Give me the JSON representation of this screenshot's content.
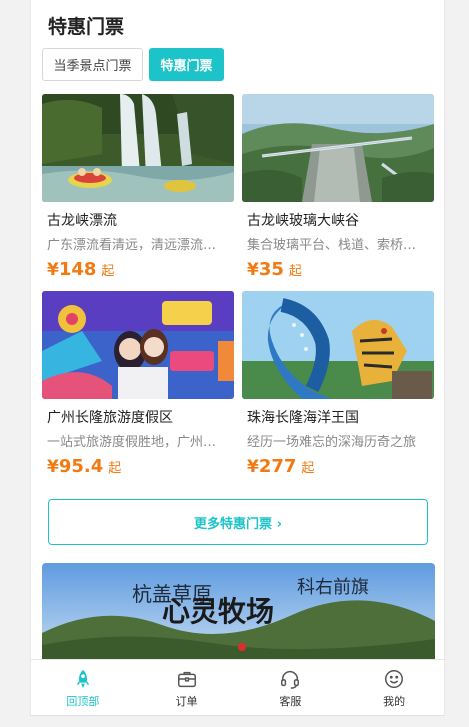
{
  "section": {
    "title": "特惠门票"
  },
  "tabs": [
    {
      "label": "当季景点门票",
      "active": false
    },
    {
      "label": "特惠门票",
      "active": true
    }
  ],
  "cards": [
    {
      "name": "古龙峡漂流",
      "desc": "广东漂流看清远，清远漂流看古龙",
      "price_symbol": "¥",
      "price": "148",
      "suffix": "起"
    },
    {
      "name": "古龙峡玻璃大峡谷",
      "desc": "集合玻璃平台、栈道、索桥于一体",
      "price_symbol": "¥",
      "price": "35",
      "suffix": "起"
    },
    {
      "name": "广州长隆旅游度假区",
      "desc": "一站式旅游度假胜地，广州必游",
      "price_symbol": "¥",
      "price": "95.4",
      "suffix": "起"
    },
    {
      "name": "珠海长隆海洋王国",
      "desc": "经历一场难忘的深海历奇之旅",
      "price_symbol": "¥",
      "price": "277",
      "suffix": "起"
    }
  ],
  "more_button": {
    "label": "更多特惠门票 ›"
  },
  "banner": {
    "text_left": "杭盖草原",
    "text_main": "心灵牧场",
    "text_right": "科右前旗"
  },
  "tabbar": [
    {
      "label": "回顶部",
      "icon": "rocket-icon",
      "active": true
    },
    {
      "label": "订单",
      "icon": "briefcase-icon",
      "active": false
    },
    {
      "label": "客服",
      "icon": "headset-icon",
      "active": false
    },
    {
      "label": "我的",
      "icon": "smile-icon",
      "active": false
    }
  ],
  "colors": {
    "accent": "#1cc3c9",
    "price": "#f27a12"
  }
}
